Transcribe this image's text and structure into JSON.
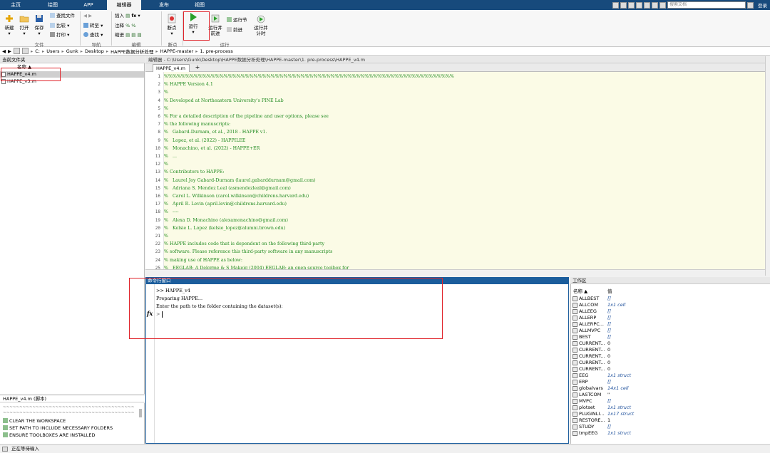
{
  "top_tabs": [
    "主页",
    "绘图",
    "APP",
    "编辑器",
    "发布",
    "视图"
  ],
  "search_placeholder": "搜索文档",
  "login": "登录",
  "ribbon": {
    "file": {
      "new": "新建",
      "open": "打开",
      "save": "保存",
      "find_files": "查找文件",
      "compare": "比较",
      "print": "打印",
      "label": "文件"
    },
    "nav": {
      "goto": "转至",
      "find": "查找",
      "label": "导航"
    },
    "edit": {
      "insert": "插入",
      "comment": "注释",
      "indent": "缩进",
      "fx": "fx",
      "label": "编辑"
    },
    "breakpoints": {
      "bp": "断点",
      "label": "断点"
    },
    "run": {
      "run": "运行",
      "run_advance": "运行并前进",
      "run_section": "运行节",
      "advance": "前进",
      "run_time": "运行并计时",
      "label": "运行"
    }
  },
  "address": [
    "C:",
    "Users",
    "Gunk",
    "Desktop",
    "HAPPE数据分析处理",
    "HAPPE-master",
    "1. pre-process"
  ],
  "left_panel": {
    "title": "当前文件夹",
    "col_name": "名称 ▲",
    "files": [
      "HAPPE_v4.m",
      "HAPPE_v3.m"
    ],
    "detail_title": "HAPPE_v4.m (脚本)",
    "detail_lines": [
      "~~~~~~~~~~~~~~~~~~~~~~~~~~~~~~~~~~~~~~~~~~~~",
      "~~~~~~~~~~~~~~~~~~~~~~~~~~~~~~~~~~~~~~~~~~~~",
      "CLEAR THE WORKSPACE",
      "SET PATH TO INCLUDE NECESSARY FOLDERS",
      "ENSURE TOOLBOXES ARE INSTALLED"
    ]
  },
  "editor": {
    "title": "编辑器 - C:\\Users\\Gunk\\Desktop\\HAPPE数据分析处理\\HAPPE-master\\1. pre-process\\HAPPE_v4.m",
    "tab": "HAPPE_v4.m",
    "plus": "+",
    "lines": [
      "%%%%%%%%%%%%%%%%%%%%%%%%%%%%%%%%%%%%%%%%%%%%%%%%%%%%%%%%%%%%%%%%%%%%",
      "% HAPPE Version 4.1",
      "%",
      "% Developed at Northeastern University's PINE Lab",
      "%",
      "% For a detailed description of the pipeline and user options, please see",
      "% the following manuscripts:",
      "%   Gabard-Durnam, et al., 2018 - HAPPE v1.",
      "%   Lopez, et al. (2022) - HAPPILEE",
      "%   Monachino, et al. (2022) - HAPPE+ER",
      "%   ...",
      "%",
      "% Contributors to HAPPE:",
      "%   Laurel Joy Gabard-Durnam (laurel.gabarddurnam@gmail.com)",
      "%   Adriana S. Mendez Leal (asmendezleal@gmail.com)",
      "%   Carol L. Wilkinson (carol.wilkinson@childrens.harvard.edu)",
      "%   April R. Levin (april.levin@childrens.harvard.edu)",
      "%   ----",
      "%   Alexa D. Monachino (alexamonachino@gmail.com)",
      "%   Kelsie L. Lopez (kelsie_lopez@alumni.brown.edu)",
      "%",
      "% HAPPE includes code that is dependent on the following third-party",
      "% software. Please reference this third-party software in any manuscripts",
      "% making use of HAPPE as below:",
      "%   EEGLAB: A Delorme & S Makeig (2004) EEGLAB: an open source toolbox for"
    ]
  },
  "command_window": {
    "title": "命令行窗口",
    "lines": [
      ">> HAPPE_v4",
      "Preparing HAPPE...",
      "Enter the path to the folder containing the dataset(s):"
    ],
    "fx": "fx",
    "prompt": ">"
  },
  "workspace": {
    "title": "工作区",
    "col_name": "名称 ▲",
    "col_value": "值",
    "vars": [
      {
        "name": "ALLBEST",
        "value": "[]",
        "italic": true
      },
      {
        "name": "ALLCOM",
        "value": "1x1 cell",
        "italic": true
      },
      {
        "name": "ALLEEG",
        "value": "[]",
        "italic": true
      },
      {
        "name": "ALLERP",
        "value": "[]",
        "italic": true
      },
      {
        "name": "ALLERPC...",
        "value": "[]",
        "italic": true
      },
      {
        "name": "ALLMVPC",
        "value": "[]",
        "italic": true
      },
      {
        "name": "BEST",
        "value": "[]",
        "italic": true
      },
      {
        "name": "CURRENT...",
        "value": "0",
        "italic": false
      },
      {
        "name": "CURRENT...",
        "value": "0",
        "italic": false
      },
      {
        "name": "CURRENT...",
        "value": "0",
        "italic": false
      },
      {
        "name": "CURRENT...",
        "value": "0",
        "italic": false
      },
      {
        "name": "CURRENT...",
        "value": "0",
        "italic": false
      },
      {
        "name": "EEG",
        "value": "1x1 struct",
        "italic": true
      },
      {
        "name": "ERP",
        "value": "[]",
        "italic": true
      },
      {
        "name": "globalvars",
        "value": "14x1 cell",
        "italic": true
      },
      {
        "name": "LASTCOM",
        "value": "''",
        "italic": false
      },
      {
        "name": "MVPC",
        "value": "[]",
        "italic": true
      },
      {
        "name": "plotset",
        "value": "1x1 struct",
        "italic": true
      },
      {
        "name": "PLUGINLI...",
        "value": "1x17 struct",
        "italic": true
      },
      {
        "name": "RESTORE...",
        "value": "1",
        "italic": false
      },
      {
        "name": "STUDY",
        "value": "[]",
        "italic": true
      },
      {
        "name": "tmpEEG",
        "value": "1x1 struct",
        "italic": true
      }
    ]
  },
  "status": "正在等待输入",
  "colors": {
    "topbar": "#174a7c",
    "cmd_header": "#1b5d9c",
    "comment": "#228b22",
    "editor_bg": "#fbfbe6",
    "highlight": "#e0242b"
  }
}
